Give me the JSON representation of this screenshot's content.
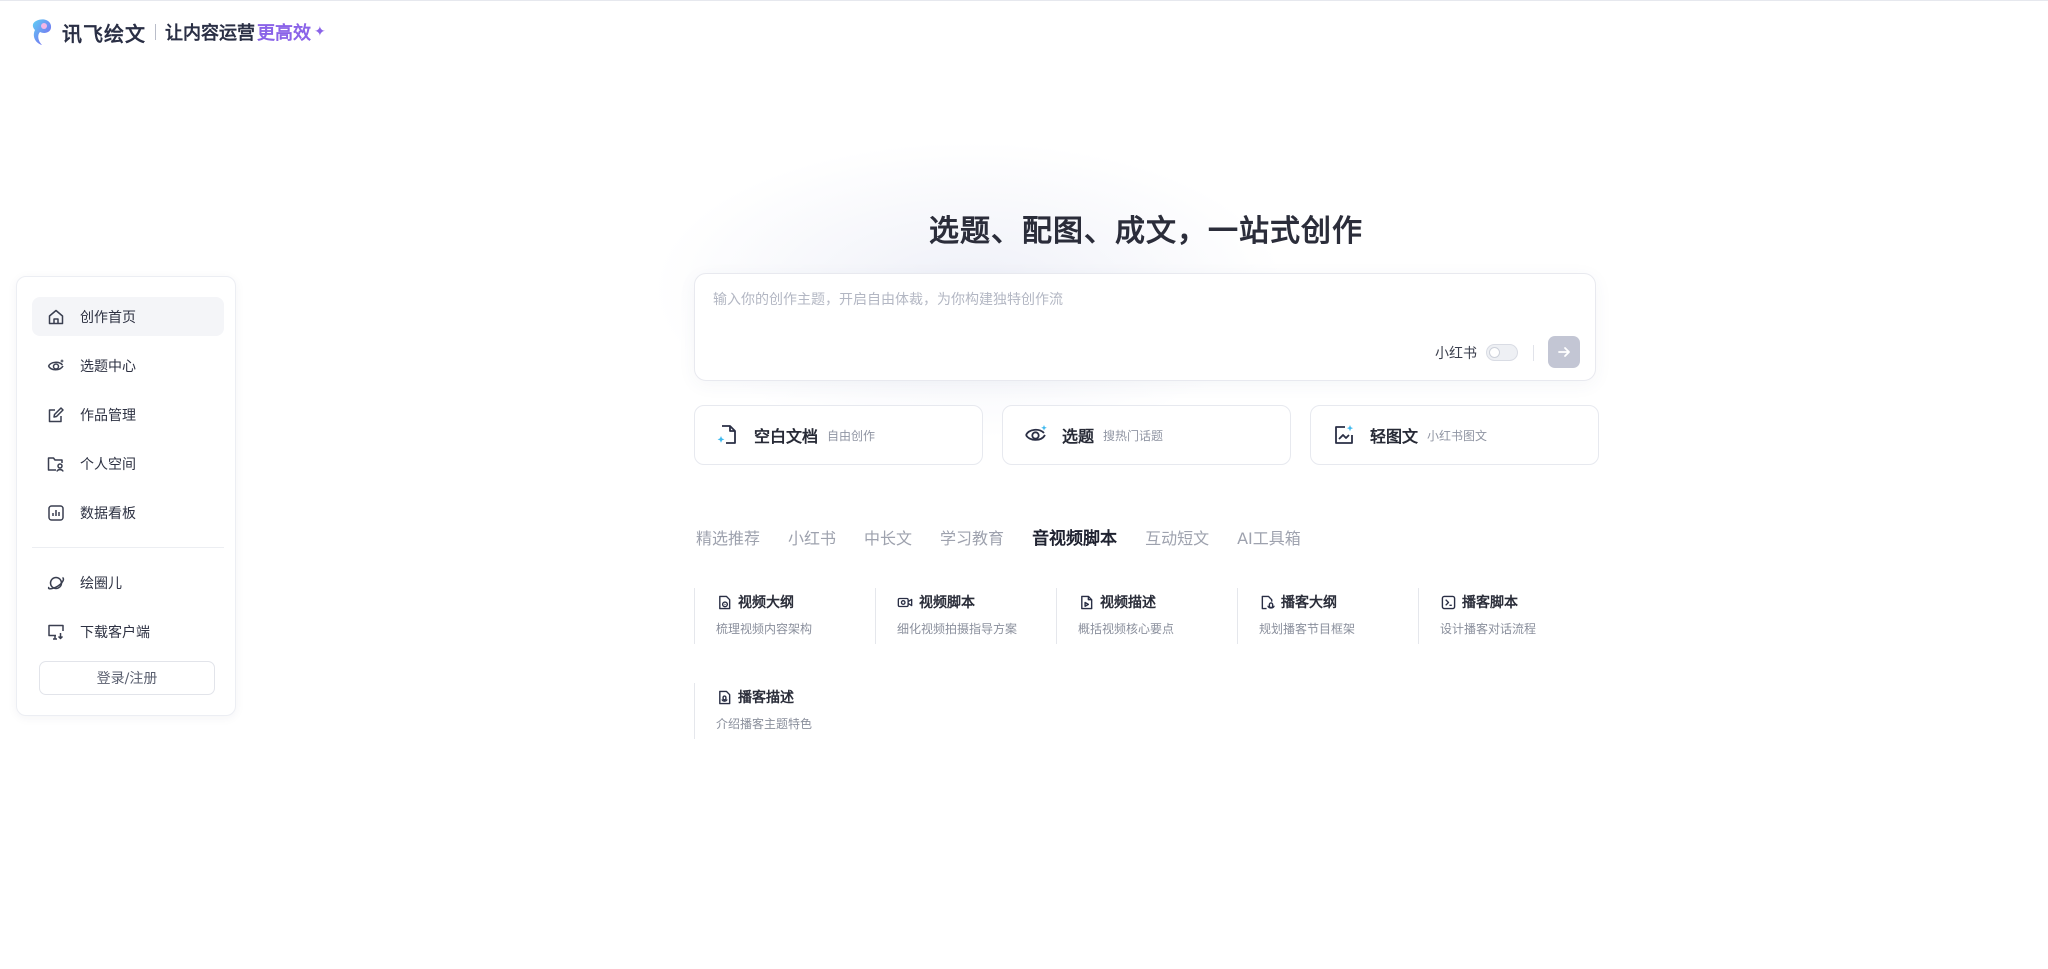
{
  "header": {
    "brand_name": "讯飞绘文",
    "slogan": "让内容运营",
    "slogan_accent": "更高效",
    "accent_color": "#8a63e8"
  },
  "sidebar": {
    "items": [
      {
        "label": "创作首页",
        "icon": "home-icon",
        "active": true
      },
      {
        "label": "选题中心",
        "icon": "eye-spark-icon",
        "active": false
      },
      {
        "label": "作品管理",
        "icon": "edit-icon",
        "active": false
      },
      {
        "label": "个人空间",
        "icon": "folder-user-icon",
        "active": false
      },
      {
        "label": "数据看板",
        "icon": "chart-icon",
        "active": false
      }
    ],
    "extra_items": [
      {
        "label": "绘圈儿",
        "icon": "planet-icon"
      },
      {
        "label": "下载客户端",
        "icon": "desktop-download-icon"
      }
    ],
    "login_label": "登录/注册"
  },
  "main": {
    "headline": "选题、配图、成文，一站式创作",
    "prompt": {
      "placeholder": "输入你的创作主题，开启自由体裁，为你构建独特创作流",
      "value": "",
      "toggle_label": "小红书",
      "toggle_on": false
    },
    "quick_cards": [
      {
        "title": "空白文档",
        "subtitle": "自由创作",
        "icon": "blank-doc-icon"
      },
      {
        "title": "选题",
        "subtitle": "搜热门话题",
        "icon": "eye-spark-icon"
      },
      {
        "title": "轻图文",
        "subtitle": "小红书图文",
        "icon": "image-text-icon"
      }
    ],
    "tabs": [
      {
        "label": "精选推荐",
        "active": false
      },
      {
        "label": "小红书",
        "active": false
      },
      {
        "label": "中长文",
        "active": false
      },
      {
        "label": "学习教育",
        "active": false
      },
      {
        "label": "音视频脚本",
        "active": true
      },
      {
        "label": "互动短文",
        "active": false
      },
      {
        "label": "AI工具箱",
        "active": false
      }
    ],
    "tools": [
      {
        "title": "视频大纲",
        "subtitle": "梳理视频内容架构",
        "icon": "video-outline-icon"
      },
      {
        "title": "视频脚本",
        "subtitle": "细化视频拍摄指导方案",
        "icon": "video-camera-icon"
      },
      {
        "title": "视频描述",
        "subtitle": "概括视频核心要点",
        "icon": "video-doc-icon"
      },
      {
        "title": "播客大纲",
        "subtitle": "规划播客节目框架",
        "icon": "podcast-outline-icon"
      },
      {
        "title": "播客脚本",
        "subtitle": "设计播客对话流程",
        "icon": "podcast-script-icon"
      },
      {
        "title": "播客描述",
        "subtitle": "介绍播客主题特色",
        "icon": "podcast-doc-icon"
      }
    ]
  }
}
